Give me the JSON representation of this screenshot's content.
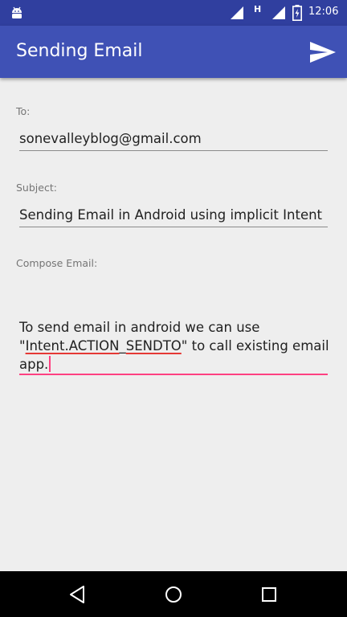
{
  "status_bar": {
    "network_type": "H",
    "time": "12:06"
  },
  "app_bar": {
    "title": "Sending Email",
    "send_icon": "send-icon"
  },
  "form": {
    "to": {
      "label": "To:",
      "value": "sonevalleyblog@gmail.com"
    },
    "subject": {
      "label": "Subject:",
      "value": "Sending Email in Android using implicit Intent"
    },
    "compose": {
      "label": "Compose Email:",
      "text_part1": "To send email in android we can use \"",
      "spell_1": "Intent.ACTION",
      "text_part2": "_",
      "spell_2": "SENDTO",
      "text_part3": "\" to call existing email app."
    }
  },
  "colors": {
    "status_bar": "#303f9f",
    "app_bar": "#3f51b5",
    "accent": "#ff4081",
    "background": "#eeeeee"
  },
  "nav_bar": {
    "back_icon": "back-icon",
    "home_icon": "home-icon",
    "recents_icon": "recents-icon"
  }
}
